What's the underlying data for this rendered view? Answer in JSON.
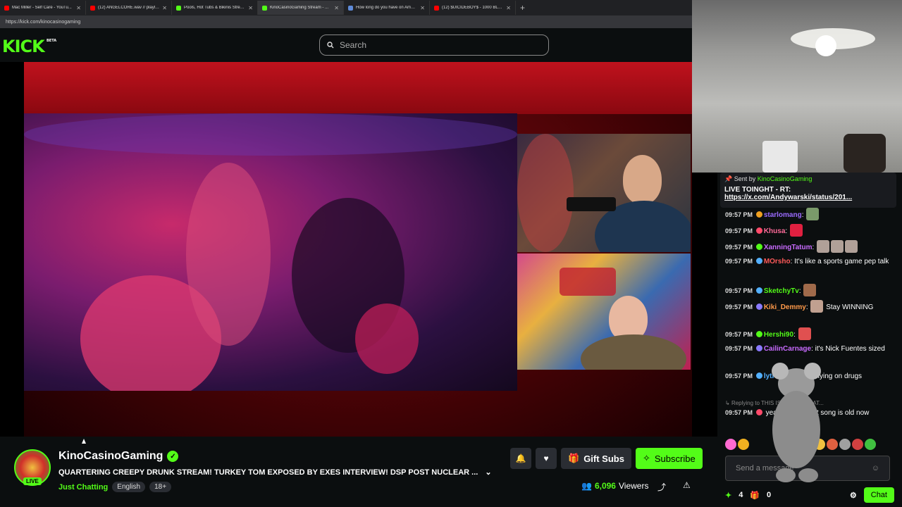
{
  "browser": {
    "tabs": [
      {
        "label": "Mac Miller - Self Care - YouTu...",
        "color": "#ff0000"
      },
      {
        "label": "(12) ANGELCORE.wav // playlist (w...",
        "color": "#ff0000"
      },
      {
        "label": "Pools, Hot Tubs & Bikinis Stream i...",
        "color": "#53fc18"
      },
      {
        "label": "KinoCasinoGaming Stream - ...",
        "color": "#53fc18",
        "active": true
      },
      {
        "label": "How long do you have on Amazo...",
        "color": "#5f8bd8"
      },
      {
        "label": "(12) $UICIDEBOY$ - 1000 BLUNTS...",
        "color": "#ff0000"
      }
    ],
    "url": "https://kick.com/kinocasinogaming"
  },
  "header": {
    "logo": "KICK",
    "logo_badge": "BETA",
    "search_placeholder": "Search"
  },
  "chat": {
    "pinned": {
      "sent_by_label": "Sent by",
      "sender": "KinoCasinoGaming",
      "text": "LIVE TOINGHT - RT:",
      "link": "https://x.com/Andywarski/status/201..."
    },
    "messages": [
      {
        "time": "09:57 PM",
        "user": "starlomang",
        "color": "#9b6bff",
        "text": ""
      },
      {
        "time": "09:57 PM",
        "user": "Khusa",
        "color": "#ff6b9a",
        "text": ""
      },
      {
        "time": "09:57 PM",
        "user": "XanningTatum",
        "color": "#c86bff",
        "text": ""
      },
      {
        "time": "09:57 PM",
        "user": "MOrsho",
        "color": "#ff5a5a",
        "text": "It's like a sports game pep talk"
      },
      {
        "time": "09:57 PM",
        "user": "SketchyTv",
        "color": "#53fc18",
        "text": ""
      },
      {
        "time": "09:57 PM",
        "user": "Kiki_Demmy",
        "color": "#ff9a4a",
        "text": "Stay WINNING"
      },
      {
        "time": "09:57 PM",
        "user": "Hershi90",
        "color": "#53fc18",
        "text": ""
      },
      {
        "time": "09:57 PM",
        "user": "CailinCarnage",
        "color": "#c86bff",
        "text": "it's Nick Fuentes sized"
      },
      {
        "time": "09:57 PM",
        "user": "lytreasure",
        "color": "#53b0ff",
        "text": "he's flying on drugs"
      },
      {
        "time": "09:57 PM",
        "user": "",
        "color": "#ff5a5a",
        "text": "yeah exactly that song is old now"
      }
    ],
    "reply_label": "Replying to",
    "reply_snippet": "THIS IS WAY TOO LAT...",
    "input_placeholder": "Send a message",
    "count_a": "4",
    "count_b": "0",
    "chat_button": "Chat"
  },
  "channel": {
    "name": "KinoCasinoGaming",
    "live_badge": "LIVE",
    "title": "QUARTERING CREEPY DRUNK STREAM! TURKEY TOM EXPOSED BY EXES INTERVIEW! DSP POST NUCLEAR ...",
    "category": "Just Chatting",
    "tags": [
      "English",
      "18+"
    ],
    "gift_label": "Gift Subs",
    "subscribe_label": "Subscribe",
    "viewer_count": "6,096",
    "viewers_label": "Viewers"
  },
  "colors": {
    "brand": "#53fc18",
    "background": "#0b0e0f"
  }
}
